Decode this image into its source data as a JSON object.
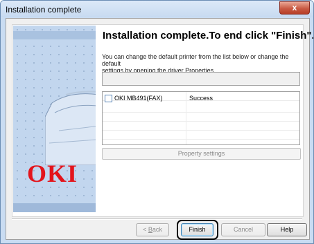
{
  "window": {
    "title": "Installation complete",
    "close_glyph": "x"
  },
  "main": {
    "heading": "Installation complete.To end click \"Finish\".",
    "info_line1": "You can change the default printer from the list below or change the default",
    "info_line2": "settings by opening the driver Properties.",
    "logo_text": "OKI",
    "printers": [
      {
        "name": "OKI MB491(FAX)",
        "status": "Success",
        "checked": false
      }
    ],
    "property_button": "Property settings"
  },
  "buttons": {
    "back_prefix": "< ",
    "back_underlined": "B",
    "back_rest": "ack",
    "finish": "Finish",
    "cancel": "Cancel",
    "help": "Help"
  },
  "colors": {
    "title_bar": "#c7daf1",
    "close_button": "#c95b44",
    "logo": "#e3141b",
    "side_panel": "#c2d6ee"
  },
  "icons": {
    "close": "close-icon",
    "checkbox": "checkbox-unchecked-icon",
    "printer_graphic": "printer-illustration"
  }
}
